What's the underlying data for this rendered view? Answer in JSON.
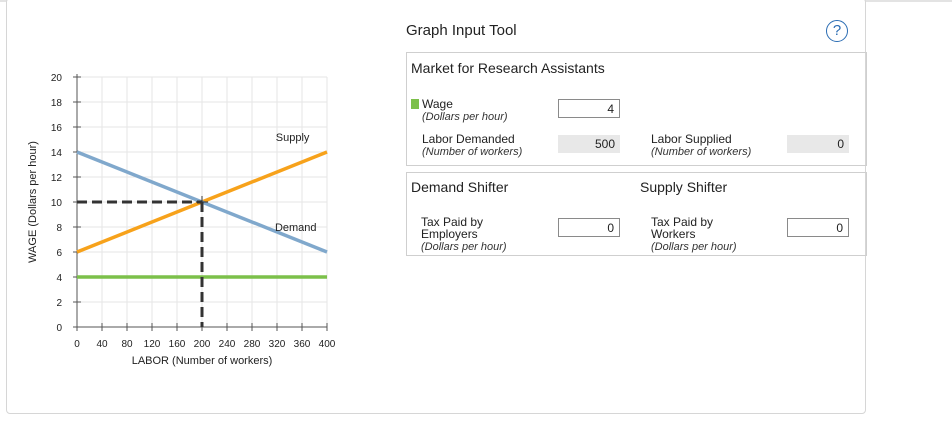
{
  "tool": {
    "title": "Graph Input Tool",
    "help_icon": "question-circle-icon",
    "help_label": "?"
  },
  "market": {
    "title": "Market for Research Assistants",
    "wage_label": "Wage",
    "wage_unit": "(Dollars per hour)",
    "wage_value": "4",
    "demanded_label": "Labor Demanded",
    "demanded_unit": "(Number of workers)",
    "demanded_value": "500",
    "supplied_label": "Labor Supplied",
    "supplied_unit": "(Number of workers)",
    "supplied_value": "0"
  },
  "demand_shifter": {
    "title": "Demand Shifter",
    "label1": "Tax Paid by",
    "label2": "Employers",
    "unit": "(Dollars per hour)",
    "value": "0"
  },
  "supply_shifter": {
    "title": "Supply Shifter",
    "label1": "Tax Paid by",
    "label2": "Workers",
    "unit": "(Dollars per hour)",
    "value": "0"
  },
  "colors": {
    "supply": "#f7a21b",
    "demand": "#80a8cc",
    "wage_line": "#7cc04a",
    "equilibrium": "#333333"
  },
  "chart_data": {
    "type": "line",
    "xlabel": "LABOR (Number of workers)",
    "ylabel": "WAGE (Dollars per hour)",
    "xlim": [
      0,
      400
    ],
    "ylim": [
      0,
      20
    ],
    "x_ticks": [
      0,
      40,
      80,
      120,
      160,
      200,
      240,
      280,
      320,
      360,
      400
    ],
    "y_ticks": [
      0,
      2,
      4,
      6,
      8,
      10,
      12,
      14,
      16,
      18,
      20
    ],
    "series": [
      {
        "name": "Supply",
        "x": [
          0,
          400
        ],
        "y": [
          6,
          14
        ]
      },
      {
        "name": "Demand",
        "x": [
          0,
          400
        ],
        "y": [
          14,
          6
        ]
      },
      {
        "name": "",
        "x": [
          0,
          400
        ],
        "y": [
          4,
          4
        ]
      }
    ],
    "equilibrium": {
      "x": 200,
      "y": 10
    }
  }
}
